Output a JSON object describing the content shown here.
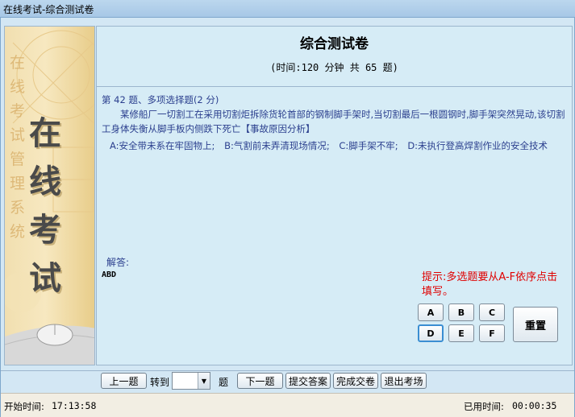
{
  "window": {
    "title": "在线考试-综合测试卷"
  },
  "banner": {
    "chars": [
      "在",
      "线",
      "考",
      "试"
    ],
    "faint_text": "在线考试管理系统"
  },
  "exam": {
    "title": "综合测试卷",
    "info": "(时间:120 分钟 共 65 题)"
  },
  "question": {
    "header": "第 42 题、多项选择题(2 分)",
    "body": "某修船厂一切割工在采用切割炬拆除货轮首部的钢制脚手架时,当切割最后一根圆钢时,脚手架突然晃动,该切割工身体失衡从脚手板内侧跌下死亡【事故原因分析】",
    "options": [
      "A:安全带未系在牢固物上;",
      "B:气割前未弄清现场情况;",
      "C:脚手架不牢;",
      "D:未执行登高焊割作业的安全技术"
    ]
  },
  "answer": {
    "label": "解答:",
    "value": "ABD"
  },
  "hint": "提示:多选题要从A-F依序点击填写。",
  "choices": [
    "A",
    "B",
    "C",
    "D",
    "E",
    "F"
  ],
  "reset_label": "重置",
  "nav": {
    "prev": "上一题",
    "goto": "转到",
    "goto_value": "",
    "goto_suffix": "题",
    "next": "下一题",
    "submit_answer": "提交答案",
    "finish": "完成交卷",
    "exit": "退出考场"
  },
  "status": {
    "start_label": "开始时间:",
    "start_time": "17:13:58",
    "used_label": "已用时间:",
    "used_time": "00:00:35"
  }
}
